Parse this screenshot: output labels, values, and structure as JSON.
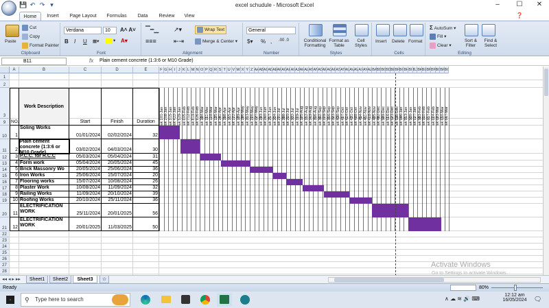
{
  "window": {
    "title": "excel  schudule  -  Microsoft Excel"
  },
  "tabs": [
    "Home",
    "Insert",
    "Page Layout",
    "Formulas",
    "Data",
    "Review",
    "View"
  ],
  "ribbon": {
    "clipboard": {
      "paste": "Paste",
      "cut": "Cut",
      "copy": "Copy",
      "format_painter": "Format Painter",
      "label": "Clipboard"
    },
    "font": {
      "name": "Verdana",
      "size": "10",
      "label": "Font",
      "bold": "B",
      "italic": "I",
      "underline": "U"
    },
    "alignment": {
      "wrap": "Wrap Text",
      "merge": "Merge & Center",
      "label": "Alignment"
    },
    "number": {
      "format": "General",
      "label": "Number",
      "currency": "$",
      "percent": "%",
      "comma": ","
    },
    "styles": {
      "conditional": "Conditional Formatting",
      "format_table": "Format as Table",
      "cell_styles": "Cell Styles",
      "label": "Styles"
    },
    "cells": {
      "insert": "Insert",
      "delete": "Delete",
      "format": "Format",
      "label": "Cells"
    },
    "editing": {
      "autosum": "AutoSum",
      "fill": "Fill",
      "clear": "Clear",
      "sort": "Sort & Filter",
      "find": "Find & Select",
      "label": "Editing"
    }
  },
  "formula_bar": {
    "name_box": "B11",
    "fx": "fx",
    "content": "Plain cement concrete (1:3:6 or M10 Grade)"
  },
  "columns": [
    "A",
    "B",
    "C",
    "D",
    "E",
    "F",
    "G",
    "H",
    "I",
    "J",
    "K",
    "L",
    "M",
    "N",
    "O",
    "P",
    "Q",
    "R",
    "S",
    "T",
    "U",
    "V",
    "W",
    "X",
    "Y",
    "Z",
    "AA",
    "AB",
    "AC",
    "AD",
    "AE",
    "AF",
    "AG",
    "AH",
    "AI",
    "AJ",
    "AK",
    "AL",
    "AM",
    "AN",
    "AO",
    "AP",
    "AQ",
    "AR",
    "AS",
    "AT",
    "AU",
    "AV",
    "AW",
    "AX",
    "AY",
    "AZ",
    "BA",
    "BB",
    "BC",
    "BD",
    "BE",
    "BF",
    "BG",
    "BH",
    "BI",
    "BJ",
    "BK",
    "BL",
    "BM",
    "BN",
    "BO",
    "BP",
    "BQ"
  ],
  "headers": {
    "no": "NO.",
    "desc": "Work Description",
    "start": "Start",
    "finish": "Finish",
    "duration": "Duration"
  },
  "weeks": [
    "01-Jan",
    "08-Jan",
    "15-Jan",
    "22-Jan",
    "29-Jan",
    "05-Feb",
    "12-Feb",
    "19-Feb",
    "26-Feb",
    "04-Mar",
    "11-Mar",
    "18-Mar",
    "25-Mar",
    "01-Apr",
    "08-Apr",
    "15-Apr",
    "22-Apr",
    "29-Apr",
    "06-May",
    "13-May",
    "20-May",
    "27-May",
    "03-Jun",
    "10-Jun",
    "17-Jun",
    "24-Jun",
    "01-Jul",
    "08-Jul",
    "15-Jul",
    "22-Jul",
    "29-Jul",
    "05-Aug",
    "12-Aug",
    "19-Aug",
    "26-Aug",
    "02-Sep",
    "09-Sep",
    "16-Sep",
    "23-Sep",
    "30-Sep",
    "07-Oct",
    "14-Oct",
    "21-Oct",
    "28-Oct",
    "04-Nov",
    "11-Nov",
    "18-Nov",
    "25-Nov",
    "02-Dec",
    "09-Dec",
    "16-Dec",
    "23-Dec",
    "30-Dec",
    "06-Jan",
    "13-Jan",
    "20-Jan",
    "27-Jan",
    "03-Feb",
    "10-Feb",
    "17-Feb",
    "24-Feb",
    "03-Mar",
    "10-Mar",
    "17-Mar"
  ],
  "tasks": [
    {
      "row": "10",
      "no": "1",
      "desc": "Soling Works",
      "start": "01/01/2024",
      "finish": "02/02/2024",
      "duration": "32",
      "start_week": 0,
      "end_week": 4.6
    },
    {
      "row": "11",
      "no": "2",
      "desc": "Plain cement concrete (1:3:6 or M10 Grade)",
      "start": "03/02/2024",
      "finish": "04/03/2024",
      "duration": "30",
      "start_week": 4.7,
      "end_week": 9.0
    },
    {
      "row": "12",
      "no": "3",
      "desc": "P.C.C. for R.C.C works",
      "start": "05/03/2024",
      "finish": "05/04/2024",
      "duration": "31",
      "start_week": 9.1,
      "end_week": 13.6
    },
    {
      "row": "13",
      "no": "4",
      "desc": "Form work",
      "start": "05/04/2024",
      "finish": "20/05/2024",
      "duration": "45",
      "start_week": 13.6,
      "end_week": 20.1
    },
    {
      "row": "14",
      "no": "5",
      "desc": "Brick Massonry Wo",
      "start": "20/05/2024",
      "finish": "25/06/2024",
      "duration": "36",
      "start_week": 20.0,
      "end_week": 25.2
    },
    {
      "row": "15",
      "no": "6",
      "desc": "Iron Works",
      "start": "25/06/2024",
      "finish": "15/07/2024",
      "duration": "20",
      "start_week": 25.1,
      "end_week": 28.0
    },
    {
      "row": "16",
      "no": "7",
      "desc": "Flooring works",
      "start": "15/07/2024",
      "finish": "10/08/2024",
      "duration": "26",
      "start_week": 28.0,
      "end_week": 31.7
    },
    {
      "row": "17",
      "no": "8",
      "desc": "Plaster Work",
      "start": "10/08/2024",
      "finish": "11/09/2024",
      "duration": "32",
      "start_week": 31.7,
      "end_week": 36.3
    },
    {
      "row": "18",
      "no": "9",
      "desc": "Railing Works",
      "start": "11/09/2024",
      "finish": "20/10/2024",
      "duration": "39",
      "start_week": 36.3,
      "end_week": 41.9
    },
    {
      "row": "19",
      "no": "10",
      "desc": "Roofing Works",
      "start": "20/10/2024",
      "finish": "25/11/2024",
      "duration": "36",
      "start_week": 41.9,
      "end_week": 47.0
    },
    {
      "row": "20",
      "no": "11",
      "desc": "ELECTRIFICATION WORK",
      "start": "25/11/2024",
      "finish": "20/01/2025",
      "duration": "56",
      "start_week": 47.0,
      "end_week": 55.0
    },
    {
      "row": "21",
      "no": "12",
      "desc": "ELECTRIFICATION WORK",
      "start": "20/01/2025",
      "finish": "11/03/2025",
      "duration": "50",
      "start_week": 55.0,
      "end_week": 62.2
    }
  ],
  "sheet_tabs": [
    "Sheet1",
    "Sheet2",
    "Sheet3"
  ],
  "active_sheet": "Sheet3",
  "status": {
    "ready": "Ready",
    "zoom": "80%"
  },
  "watermark": {
    "line1": "Activate Windows",
    "line2": "Go to Settings to activate Windows."
  },
  "taskbar": {
    "search_placeholder": "Type here to search",
    "time": "12:12 am",
    "date": "16/05/2024"
  },
  "colors": {
    "bar": "#7030a0",
    "header_bg": "#e4ecf7"
  }
}
